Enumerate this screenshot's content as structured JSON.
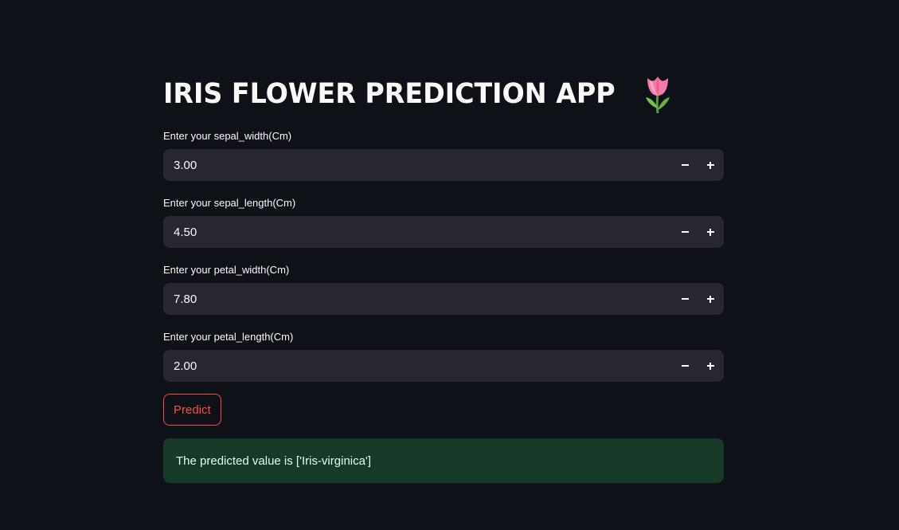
{
  "app": {
    "title": "IRIS FLOWER PREDICTION APP",
    "title_icon": "tulip-icon"
  },
  "fields": [
    {
      "label": "Enter your sepal_width(Cm)",
      "value": "3.00"
    },
    {
      "label": "Enter your sepal_length(Cm)",
      "value": "4.50"
    },
    {
      "label": "Enter your petal_width(Cm)",
      "value": "7.80"
    },
    {
      "label": "Enter your petal_length(Cm)",
      "value": "2.00"
    }
  ],
  "predict_button": {
    "label": "Predict"
  },
  "result": {
    "text": "The predicted value is ['Iris-virginica']"
  },
  "colors": {
    "background": "#0e1117",
    "input_background": "#262730",
    "accent": "#ff4b4b",
    "success_background": "#173928",
    "success_text": "#dffde9",
    "text": "#fafafa"
  }
}
